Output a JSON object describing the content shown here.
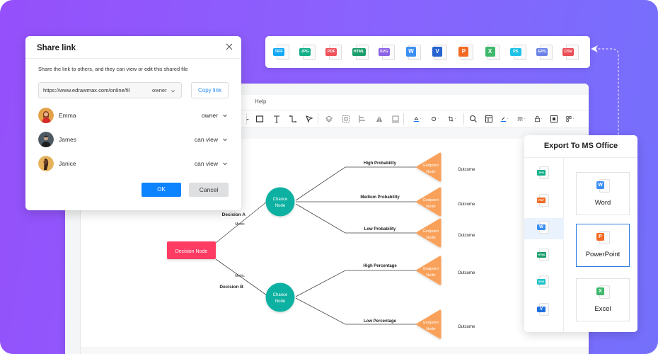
{
  "editor": {
    "menu": {
      "help_label": "Help"
    },
    "toolbar_icons": [
      "rectangle-icon",
      "text-icon",
      "connector-icon",
      "select-pointer-icon",
      "layers-icon",
      "group-icon",
      "align-icon",
      "flip-icon",
      "frame-icon",
      "fill-color-icon",
      "shape-style-icon",
      "crop-icon",
      "search-icon",
      "data-icon",
      "line-color-icon",
      "line-style-icon",
      "lock-icon",
      "fit-icon",
      "more-icon"
    ]
  },
  "diagram": {
    "decision_node": "Decision Node",
    "branches": [
      {
        "label": "Decision A",
        "metric": "Metric",
        "chance_node": [
          "Chance",
          "Node"
        ],
        "outcomes": [
          {
            "label": "High Probability",
            "endpoint": [
              "Endpoint",
              "Node"
            ],
            "result": "Outcome"
          },
          {
            "label": "Medium Probability",
            "endpoint": [
              "Endpoint",
              "Node"
            ],
            "result": "Outcome"
          },
          {
            "label": "Low Probability",
            "endpoint": [
              "Endpoint",
              "Node"
            ],
            "result": "Outcome"
          }
        ]
      },
      {
        "label": "Decision B",
        "metric": "Metric",
        "chance_node": [
          "Chance",
          "Node"
        ],
        "outcomes": [
          {
            "label": "High Percentage",
            "endpoint": [
              "Endpoint",
              "Node"
            ],
            "result": "Outcome"
          },
          {
            "label": "Low Percentage",
            "endpoint": [
              "Endpoint",
              "Node"
            ],
            "result": "Outcome"
          }
        ]
      }
    ],
    "colors": {
      "decision": "#fe3a63",
      "chance": "#0cb1a1",
      "endpoint": "#f9a15a"
    }
  },
  "share": {
    "title": "Share link",
    "description": "Share the link to others, and they can view or edit this shared file",
    "link_value": "https://www.edrawmax.com/online/fil",
    "link_permission": "owner",
    "copy_label": "Copy link",
    "people": [
      {
        "name": "Emma",
        "role": "owner"
      },
      {
        "name": "James",
        "role": "can view"
      },
      {
        "name": "Janice",
        "role": "can view"
      }
    ],
    "ok_label": "OK",
    "cancel_label": "Cancel"
  },
  "formats": [
    {
      "label": "TIFF",
      "color": "#12a8f5"
    },
    {
      "label": "JPG",
      "color": "#15b08a"
    },
    {
      "label": "PDF",
      "color": "#f0515b"
    },
    {
      "label": "HTML",
      "color": "#1a9e6c"
    },
    {
      "label": "SVG",
      "color": "#8b63e6"
    },
    {
      "label": "W",
      "color": "#3b8ff3"
    },
    {
      "label": "V",
      "color": "#2463d0"
    },
    {
      "label": "P",
      "color": "#f26a22"
    },
    {
      "label": "X",
      "color": "#3db86b"
    },
    {
      "label": "PS",
      "color": "#1ec2e6"
    },
    {
      "label": "EPS",
      "color": "#6b83e8"
    },
    {
      "label": "CSV",
      "color": "#ea4d55"
    }
  ],
  "export": {
    "title": "Export To MS Office",
    "sidebar": [
      {
        "label": "JPG",
        "color": "#15b08a",
        "selected": false
      },
      {
        "label": "PDF",
        "color": "#f26a22",
        "selected": false
      },
      {
        "label": "W",
        "color": "#3b8ff3",
        "selected": true
      },
      {
        "label": "HTML",
        "color": "#1a9e6c",
        "selected": false
      },
      {
        "label": "SVG",
        "color": "#1ec2c8",
        "selected": false
      },
      {
        "label": "V",
        "color": "#2070e0",
        "selected": false
      }
    ],
    "options": [
      {
        "label": "Word",
        "tag": "W",
        "color": "#3b8ff3",
        "selected": false
      },
      {
        "label": "PowerPoint",
        "tag": "P",
        "color": "#f26a22",
        "selected": true
      },
      {
        "label": "Excel",
        "tag": "X",
        "color": "#3db86b",
        "selected": false
      }
    ]
  }
}
